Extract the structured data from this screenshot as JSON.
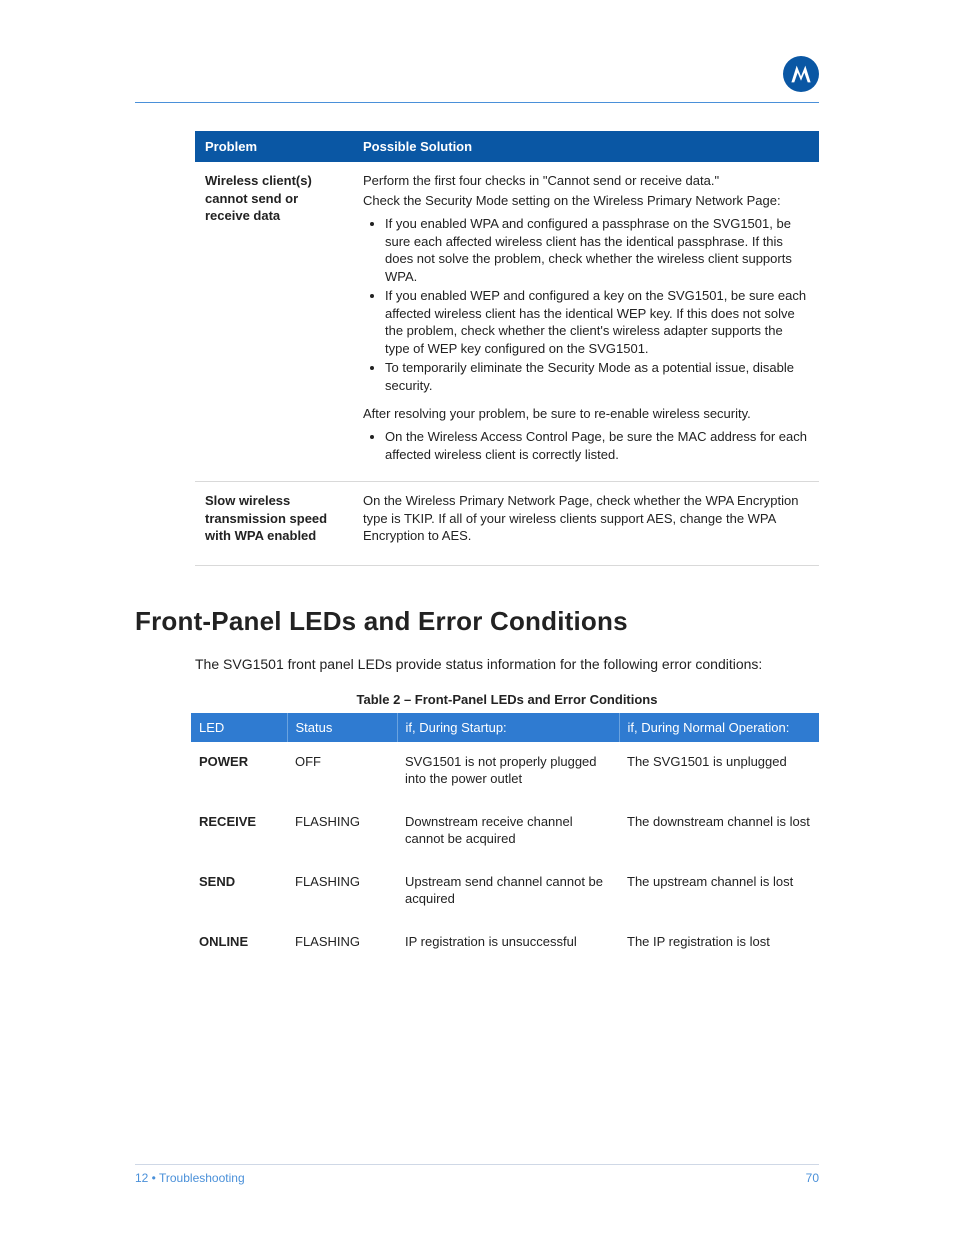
{
  "table1": {
    "headers": {
      "problem": "Problem",
      "solution": "Possible Solution"
    },
    "rows": [
      {
        "problem": "Wireless client(s) cannot send or receive data",
        "sol_p1": "Perform the first four checks in \"Cannot send or receive data.\"",
        "sol_p2": "Check the Security Mode setting on the Wireless Primary Network Page:",
        "bullets1": [
          "If you enabled WPA and configured a passphrase on the SVG1501, be sure each affected wireless client has the identical passphrase. If this does not solve the problem, check whether the wireless client supports WPA.",
          "If you enabled WEP and configured a key on the SVG1501, be sure each affected wireless client has the identical WEP key. If this does not solve the problem, check whether the client's wireless adapter supports the type of WEP key configured on the SVG1501.",
          "To temporarily eliminate the Security Mode as a potential issue, disable security."
        ],
        "sol_p3": "After resolving your problem, be sure to re-enable wireless security.",
        "bullets2": [
          "On the Wireless Access Control Page, be sure the MAC address for each affected wireless client is correctly listed."
        ]
      },
      {
        "problem": "Slow wireless transmission speed with WPA enabled",
        "sol_p1": "On the Wireless Primary Network Page, check whether the WPA Encryption type is TKIP. If all of your wireless clients support AES, change the WPA Encryption to AES."
      }
    ]
  },
  "section_heading": "Front-Panel LEDs and Error Conditions",
  "intro": "The SVG1501 front panel LEDs provide status information for the following error conditions:",
  "table2": {
    "caption": "Table 2 – Front-Panel LEDs and Error Conditions",
    "headers": {
      "led": "LED",
      "status": "Status",
      "startup": "if, During Startup:",
      "normal": "if, During Normal Operation:"
    },
    "rows": [
      {
        "led": "POWER",
        "status": "OFF",
        "startup": "SVG1501 is not properly plugged into the power outlet",
        "normal": "The SVG1501 is unplugged"
      },
      {
        "led": "RECEIVE",
        "status": "FLASHING",
        "startup": "Downstream receive channel cannot be acquired",
        "normal": "The downstream channel is lost"
      },
      {
        "led": "SEND",
        "status": "FLASHING",
        "startup": "Upstream send channel cannot be acquired",
        "normal": "The upstream channel is lost"
      },
      {
        "led": "ONLINE",
        "status": "FLASHING",
        "startup": "IP registration is unsuccessful",
        "normal": "The IP registration is lost"
      }
    ]
  },
  "footer": {
    "left": "12 • Troubleshooting",
    "right": "70"
  }
}
